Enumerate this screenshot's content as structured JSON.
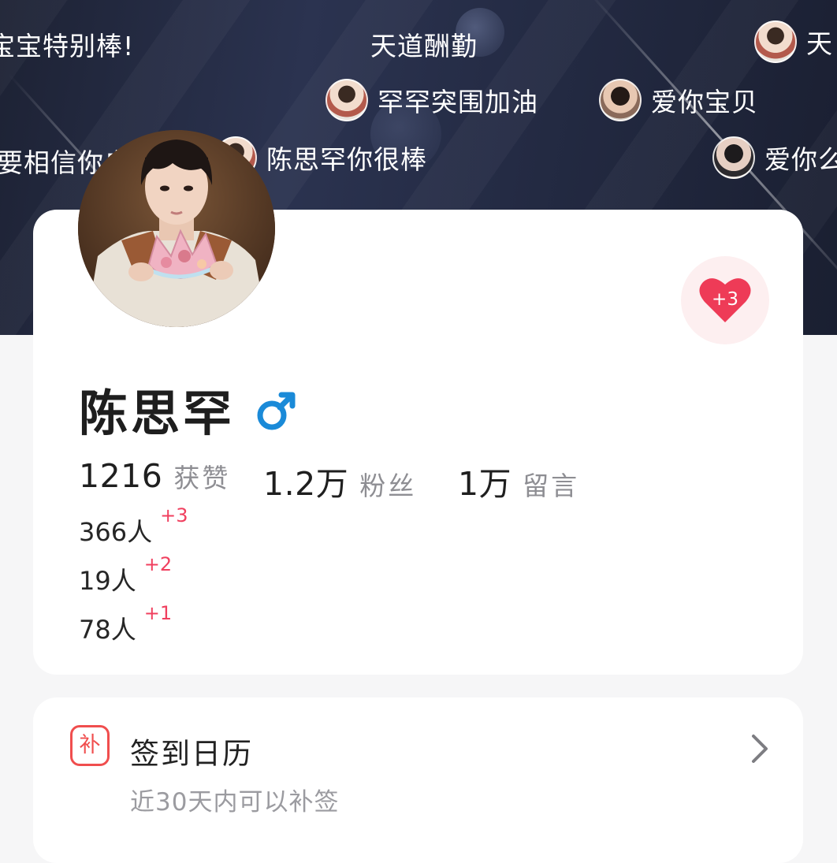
{
  "danmaku": [
    {
      "text": "宝宝特别棒!",
      "has_avatar": false
    },
    {
      "text": "天道酬勤",
      "has_avatar": false
    },
    {
      "text": "天",
      "has_avatar": true
    },
    {
      "text": "罕罕突围加油",
      "has_avatar": true
    },
    {
      "text": "爱你宝贝",
      "has_avatar": true
    },
    {
      "text": "要相信你自",
      "has_avatar": false
    },
    {
      "text": "陈思罕你很棒",
      "has_avatar": true
    },
    {
      "text": "爱你么",
      "has_avatar": true
    }
  ],
  "profile": {
    "name": "陈思罕",
    "gender_symbol": "♂",
    "gender": "male",
    "like_badge": "+3",
    "stats": [
      {
        "value": "1216",
        "label": "获赞"
      },
      {
        "value": "1.2万",
        "label": "粉丝"
      },
      {
        "value": "1万",
        "label": "留言"
      }
    ],
    "people": [
      {
        "count": "366人",
        "delta": "+3"
      },
      {
        "count": "19人",
        "delta": "+2"
      },
      {
        "count": "78人",
        "delta": "+1"
      }
    ]
  },
  "signin": {
    "icon_char": "补",
    "title": "签到日历",
    "subtitle": "近30天内可以补签"
  },
  "colors": {
    "accent_red": "#f04e4e",
    "delta_red": "#f0405f",
    "male_blue": "#1a8ad8",
    "hero_dark": "#242b44"
  }
}
